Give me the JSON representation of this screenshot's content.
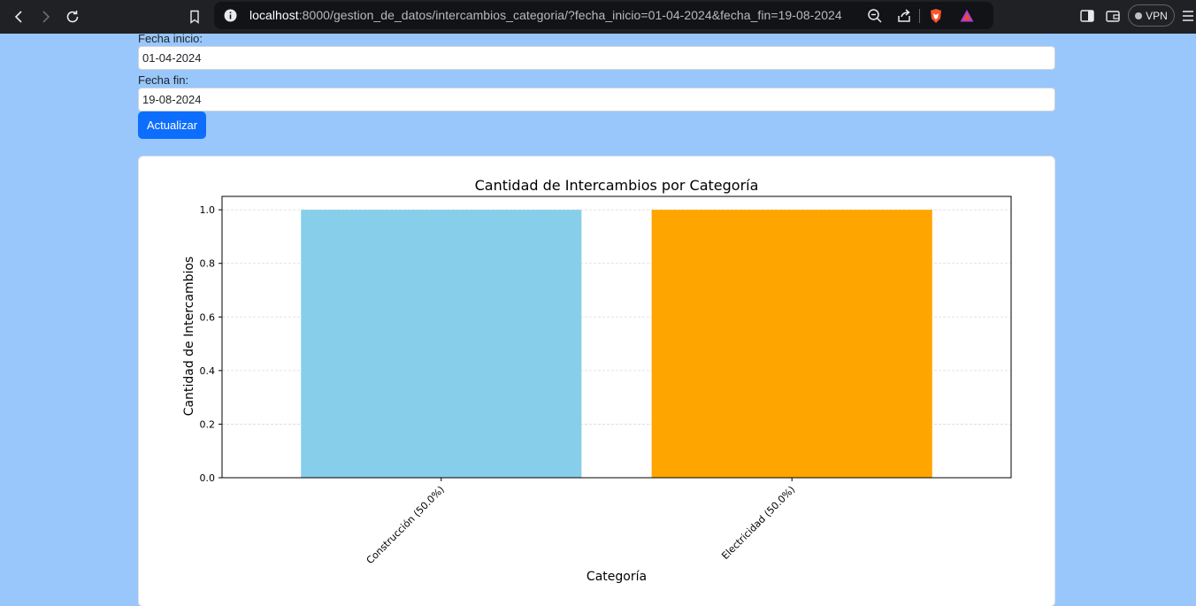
{
  "browser": {
    "url_host": "localhost",
    "url_rest": ":8000/gestion_de_datos/intercambios_categoria/?fecha_inicio=01-04-2024&fecha_fin=19-08-2024",
    "vpn_label": "VPN"
  },
  "form": {
    "start_label": "Fecha inicio:",
    "start_value": "01-04-2024",
    "end_label": "Fecha fin:",
    "end_value": "19-08-2024",
    "submit_label": "Actualizar"
  },
  "chart_data": {
    "type": "bar",
    "title": "Cantidad de Intercambios por Categoría",
    "xlabel": "Categoría",
    "ylabel": "Cantidad de Intercambios",
    "categories": [
      "Construcción (50.0%)",
      "Electricidad (50.0%)"
    ],
    "values": [
      1.0,
      1.0
    ],
    "colors": [
      "#87ceeb",
      "#ffa500"
    ],
    "ylim": [
      0,
      1.05
    ],
    "yticks": [
      0.0,
      0.2,
      0.4,
      0.6,
      0.8,
      1.0
    ],
    "ytick_labels": [
      "0.0",
      "0.2",
      "0.4",
      "0.6",
      "0.8",
      "1.0"
    ],
    "grid": "y",
    "xtick_rotation": 45
  }
}
